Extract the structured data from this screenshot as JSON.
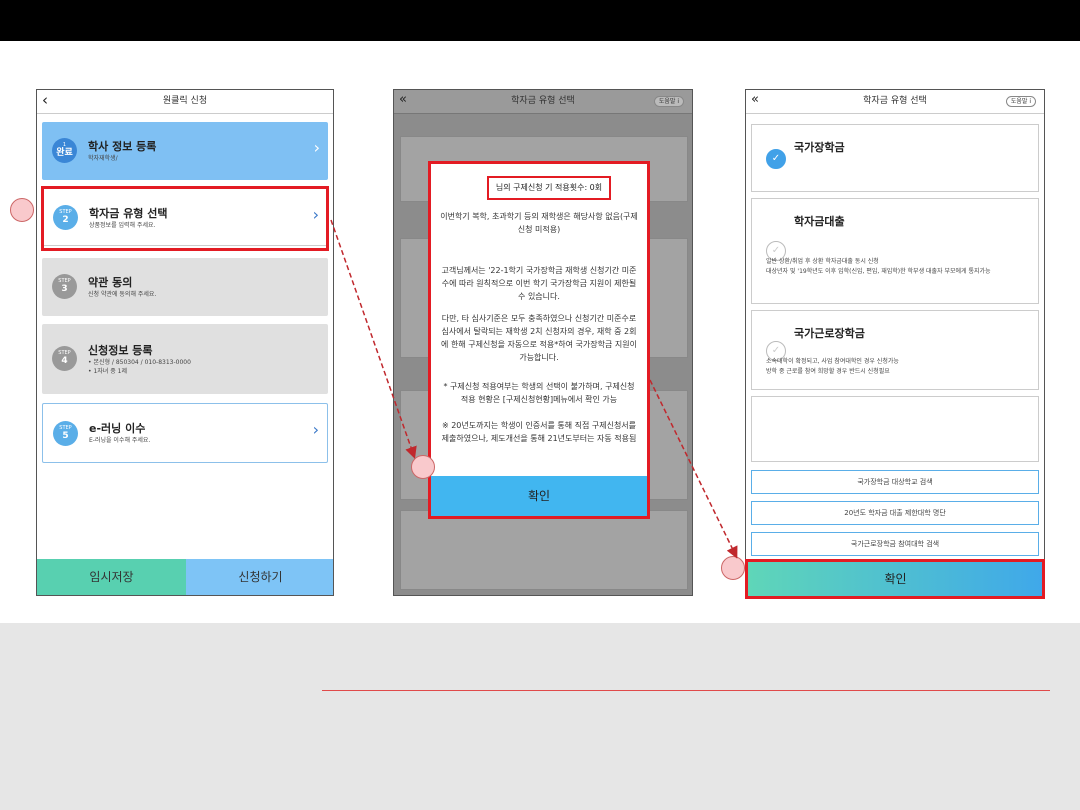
{
  "phone1": {
    "title": "원클릭 신청",
    "back": "‹",
    "cards": [
      {
        "badge_top": "1",
        "badge_bottom": "완료",
        "title": "학사 정보 등록",
        "sub": "학자재학생/",
        "color": "#7fc0f3",
        "badge_color": "#3a86d6"
      },
      {
        "badge_top": "STEP",
        "badge_bottom": "2",
        "title": "학자금 유형 선택",
        "sub": "상품정보를 입력해 주세요.",
        "color": "#ffffff",
        "badge_color": "#5aaee8"
      },
      {
        "badge_top": "STEP",
        "badge_bottom": "3",
        "title": "약관 동의",
        "sub": "신청 약관에 동의해 주세요.",
        "color": "#e0e0e0",
        "badge_color": "#999999"
      },
      {
        "badge_top": "STEP",
        "badge_bottom": "4",
        "title": "신청정보 등록",
        "sub": "• 본신형 / 850304 / 010-8313-0000",
        "sub2": "• 1자녀 중 1제",
        "color": "#e0e0e0",
        "badge_color": "#999999"
      },
      {
        "badge_top": "STEP",
        "badge_bottom": "5",
        "title": "e-러닝 이수",
        "sub": "E-러닝을 이수해 주세요.",
        "color": "#ffffff",
        "badge_color": "#5aaee8"
      }
    ],
    "save_label": "임시저장",
    "apply_label": "신청하기"
  },
  "phone2": {
    "title": "학자금 유형 선택",
    "help": "도움말 i",
    "dialog": {
      "title": "님의 구제신청 기 적용횟수: 0회",
      "p1": "이번학기 복학, 초과학기 등의 재학생은 해당사항 없음(구제신청 미적용)",
      "p2": "고객님께서는 '22-1학기 국가장학금 재학생 신청기간 미준수에 따라 원칙적으로 이번 학기 국가장학금 지원이 제한될 수 있습니다.",
      "p3": "다만, 타 심사기준은 모두 충족하였으나 신청기간 미준수로 심사에서 탈락되는 재학생 2치 신청자의 경우, 재학 중 2회에 한해 구제신청을 자동으로 적용*하여 국가장학금 지원이 가능합니다.",
      "p4": "* 구제신청 적용여부는 학생의 선택이 불가하며, 구제신청 적용 현황은 [구제신청현황]메뉴에서 확인 가능",
      "p5": "※ 20년도까지는 학생이 인증서를 통해 직접 구제신청서를 제출하였으나, 제도개선을 통해 21년도부터는 자동 적용됨",
      "confirm": "확인"
    }
  },
  "phone3": {
    "title": "학자금 유형 선택",
    "help": "도움말 i",
    "options": [
      {
        "title": "국가장학금",
        "checked": true,
        "text": "",
        "text2": ""
      },
      {
        "title": "학자금대출",
        "checked": false,
        "text": "일반 상환/취업 후 상환 학자금대출 동시 신청",
        "text2": "대상년자 및 '19학년도 이후 입학(신입, 편입, 재입학)한 학부생 대출자 부모에게 통지가능"
      },
      {
        "title": "국가근로장학금",
        "checked": false,
        "text": "소속대학이 확정되고, 사업 참여대학인 경우 신청가능",
        "text2": "방학 중 근로를 참여 희망할 경우 반드시 신청필요"
      }
    ],
    "links": [
      "국가장학금 대상학교 검색",
      "20년도 학자금 대출 제한대학 명단",
      "국가근로장학금 참여대학 검색"
    ],
    "confirm": "확인"
  }
}
